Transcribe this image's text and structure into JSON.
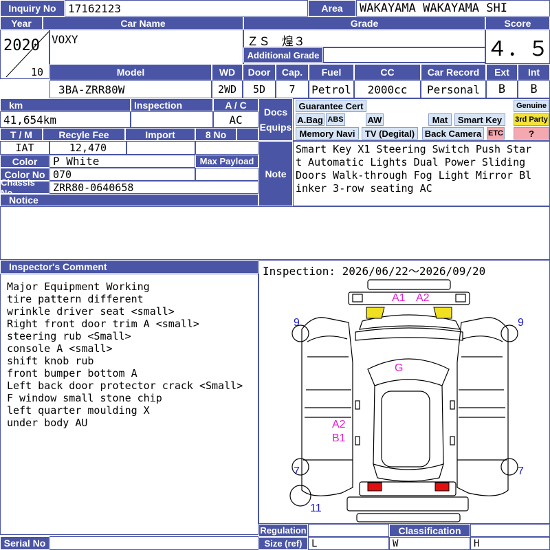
{
  "header": {
    "inquiry_label": "Inquiry No",
    "inquiry_no": "17162123",
    "area_label": "Area",
    "area": "WAKAYAMA WAKAYAMA SHI"
  },
  "row1": {
    "year_label": "Year",
    "car_name_label": "Car Name",
    "grade_label": "Grade",
    "score_label": "Score",
    "year": "2020",
    "month": "10",
    "car_name": "VOXY",
    "grade": "ＺＳ　煌３",
    "additional_grade_label": "Additional Grade",
    "score": "４．５"
  },
  "row2": {
    "model_label": "Model",
    "wd_label": "WD",
    "door_label": "Door",
    "cap_label": "Cap.",
    "fuel_label": "Fuel",
    "cc_label": "CC",
    "car_record_label": "Car Record",
    "ext_label": "Ext",
    "int_label": "Int",
    "model": "3BA-ZRR80W",
    "wd": "2WD",
    "door": "5D",
    "cap": "7",
    "fuel": "Petrol",
    "cc": "2000cc",
    "car_record": "Personal",
    "ext": "B",
    "int": "B"
  },
  "row3": {
    "km_label": "km",
    "inspection_label": "Inspection",
    "ac_label": "A / C",
    "km": "41,654km",
    "ac": "AC",
    "tm_label": "T / M",
    "recycle_label": "Recyle Fee",
    "import_label": "Import",
    "no8_label": "8 No",
    "tm": "IAT",
    "recycle": "12,470",
    "color_label": "Color",
    "color": "P White",
    "max_payload_label": "Max Payload",
    "color_no_label": "Color No",
    "color_no": "070",
    "chassis_label": "Chassis No",
    "chassis": "ZRR80-0640658",
    "notice_label": "Notice"
  },
  "docs": {
    "docs_label": "Docs",
    "equips_label": "Equips",
    "guarantee": "Guarantee Cert",
    "genuine": "Genuine",
    "abag": "A.Bag",
    "abs": "ABS",
    "aw": "AW",
    "mat": "Mat",
    "smart_key": "Smart Key",
    "third_party": "3rd Party",
    "memory_navi": "Memory Navi",
    "tv": "TV (Degital)",
    "back_camera": "Back Camera",
    "etc": "ETC",
    "question": "?"
  },
  "note": {
    "label": "Note",
    "text": "Smart Key X1 Steering Switch Push Start Automatic Lights Dual Power Sliding Doors Walk-through Fog Light Mirror Blinker 3-row seating AC"
  },
  "inspector": {
    "label": "Inspector's Comment",
    "lines": [
      "Major Equipment Working",
      "tire pattern different",
      "wrinkle driver seat <small>",
      "Right front door trim A <small>",
      "steering rub <Small>",
      "console A <small>",
      "shift knob rub",
      "front bumper bottom A",
      "Left back door protector crack <Small>",
      "F window small stone chip",
      "left quarter moulding X",
      "under body AU"
    ]
  },
  "inspection": {
    "text": "Inspection: 2026/06/22～2026/09/20"
  },
  "diagram_marks": {
    "a1": "A1",
    "a2_front": "A2",
    "g": "G",
    "a2_side": "A2",
    "b1": "B1",
    "nine_left": "9",
    "nine_right": "9",
    "seven_left": "7",
    "seven_right": "7",
    "eleven": "11"
  },
  "footer": {
    "serial_label": "Serial No",
    "regulation_label": "Regulation",
    "size_label": "Size (ref)",
    "classification_label": "Classification",
    "l": "L",
    "w": "W",
    "h": "H"
  },
  "colors": {
    "header_bg": "#4a55a6",
    "mark_blue": "#1a1ad0",
    "mark_magenta": "#e020d0",
    "tail_red": "#e01010",
    "headlight_yellow": "#f0e020"
  }
}
